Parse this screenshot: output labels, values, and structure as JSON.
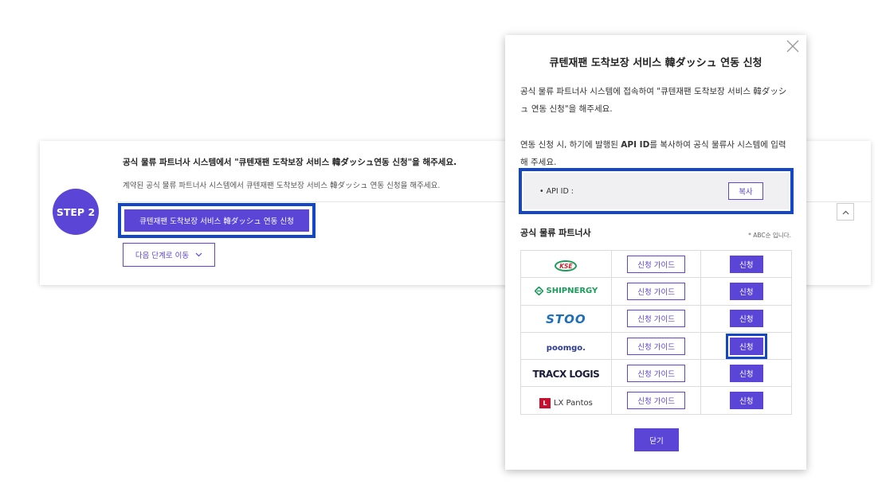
{
  "step": {
    "badge": "STEP 2",
    "title": "공식 물류 파트너사 시스템에서 \"큐텐재팬 도착보장 서비스 韓ダッシュ연동 신청\"을 해주세요.",
    "description": "계약된 공식 물류 파트너사 시스템에서 큐텐재팬 도착보장 서비스 韓ダッシュ 연동 신청을 해주세요.",
    "apply_button": "큐텐재팬 도착보장 서비스 韓ダッシュ 연동 신청",
    "next_button": "다음 단계로 이동",
    "next_icon": "chevron-down-icon",
    "collapse_icon": "chevron-up-icon"
  },
  "modal": {
    "title": "큐텐재팬 도착보장 서비스 韓ダッシュ 연동 신청",
    "close_icon": "close-icon",
    "para1": "공식 물류 파트너사 시스템에 접속하여 \"큐텐재팬 도착보장 서비스 韓ダッシュ 연동 신청\"을 해주세요.",
    "para2_a": "연동 신청 시, 하기에 발행된 ",
    "para2_b": "API ID",
    "para2_c": "를 복사하여 공식 물류사 시스템에 입력해 주세요.",
    "api_label": "• API ID :",
    "copy_button": "복사",
    "partners_title": "공식 물류 파트너사",
    "partners_note": "* ABC순 입니다.",
    "guide_label": "신청 가이드",
    "apply_label": "신청",
    "partners": [
      {
        "name": "KSE"
      },
      {
        "name": "SHIPNERGY"
      },
      {
        "name": "STOO"
      },
      {
        "name": "poomgo."
      },
      {
        "name": "TRACX LOGIS"
      },
      {
        "name": "LX Pantos"
      }
    ],
    "close_button": "닫기"
  },
  "colors": {
    "accent": "#5b45d6",
    "highlight": "#1446c8"
  }
}
